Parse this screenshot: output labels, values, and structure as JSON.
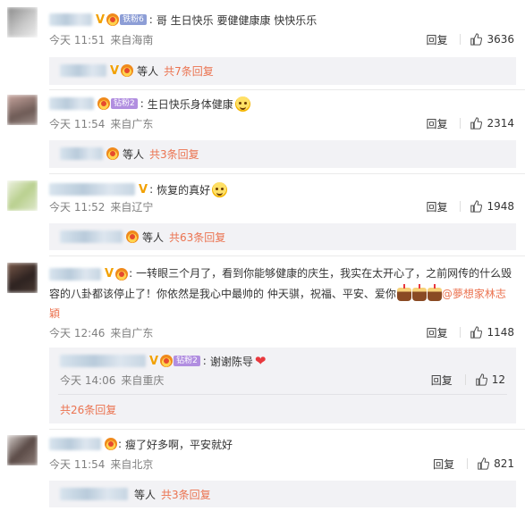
{
  "comments": [
    {
      "fan_label": "铁粉6",
      "text": "哥 生日快乐 要健健康康 快快乐乐",
      "date": "今天 11:51",
      "location": "来自海南",
      "reply_label": "回复",
      "likes": "3636",
      "sub_summary_people": "等人",
      "sub_summary_count": "共7条回复",
      "avatar_colors": [
        "#8a8a8a",
        "#c9c9c9"
      ]
    },
    {
      "fan_label": "钻粉2",
      "text": "生日快乐身体健康",
      "date": "今天 11:54",
      "location": "来自广东",
      "reply_label": "回复",
      "likes": "2314",
      "sub_summary_people": "等人",
      "sub_summary_count": "共3条回复",
      "avatar_colors": [
        "#c9a7a0",
        "#6d5a55"
      ]
    },
    {
      "text": "恢复的真好",
      "date": "今天 11:52",
      "location": "来自辽宁",
      "reply_label": "回复",
      "likes": "1948",
      "sub_summary_people": "等人",
      "sub_summary_count": "共63条回复",
      "avatar_colors": [
        "#b9d08e",
        "#eef2e2"
      ]
    },
    {
      "text": "一转眼三个月了，看到你能够健康的庆生，我实在太开心了，之前网传的什么毁容的八卦都该停止了！你依然是我心中最帅的 仲天骐，祝福、平安、爱你",
      "mention": "@夢想家林志穎",
      "date": "今天 12:46",
      "location": "来自广东",
      "reply_label": "回复",
      "likes": "1148",
      "sub_reply": {
        "fan_label": "钻粉2",
        "text": "谢谢陈导",
        "date": "今天 14:06",
        "location": "来自重庆",
        "reply_label": "回复",
        "likes": "12"
      },
      "sub_total": "共26条回复",
      "avatar_colors": [
        "#7a5a4a",
        "#2d2220"
      ]
    },
    {
      "text": "瘦了好多啊，平安就好",
      "date": "今天 11:54",
      "location": "来自北京",
      "reply_label": "回复",
      "likes": "821",
      "sub_summary_people": "等人",
      "sub_summary_count": "共3条回复",
      "avatar_colors": [
        "#5a4a46",
        "#d9d2cf"
      ]
    }
  ],
  "colors": {
    "link": "#eb7350",
    "meta_gray": "#808080",
    "sub_bg": "#f2f2f5",
    "vip_orange": "#f2a102"
  },
  "icons": {
    "like": "thumbs-up-icon",
    "vip": "v-badge-icon",
    "fan": "fan-crown-icon"
  }
}
